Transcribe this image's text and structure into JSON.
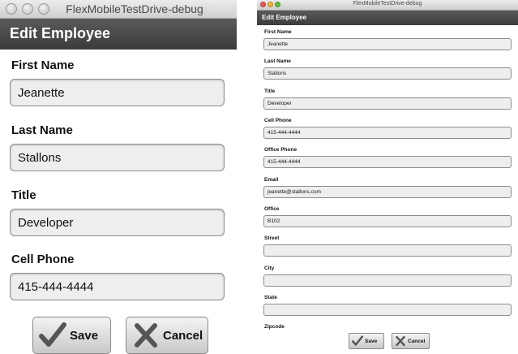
{
  "window_title": "FlexMobileTestDrive-debug",
  "header_title": "Edit Employee",
  "save_label": "Save",
  "cancel_label": "Cancel",
  "fields": [
    {
      "label": "First Name",
      "value": "Jeanette"
    },
    {
      "label": "Last Name",
      "value": "Stallons"
    },
    {
      "label": "Title",
      "value": "Developer"
    },
    {
      "label": "Cell Phone",
      "value": "415-444-4444"
    },
    {
      "label": "Office Phone",
      "value": "415-444-4444"
    },
    {
      "label": "Email",
      "value": "jeanette@stallons.com"
    },
    {
      "label": "Office",
      "value": "B102"
    },
    {
      "label": "Street",
      "value": ""
    },
    {
      "label": "City",
      "value": ""
    },
    {
      "label": "State",
      "value": ""
    },
    {
      "label": "Zipcode",
      "value": ""
    }
  ],
  "icons": {
    "save": "checkmark-icon",
    "cancel": "x-icon"
  },
  "colors": {
    "header_bg": "#454545",
    "field_bg": "#eeeeee",
    "checkmark": "#555555"
  }
}
